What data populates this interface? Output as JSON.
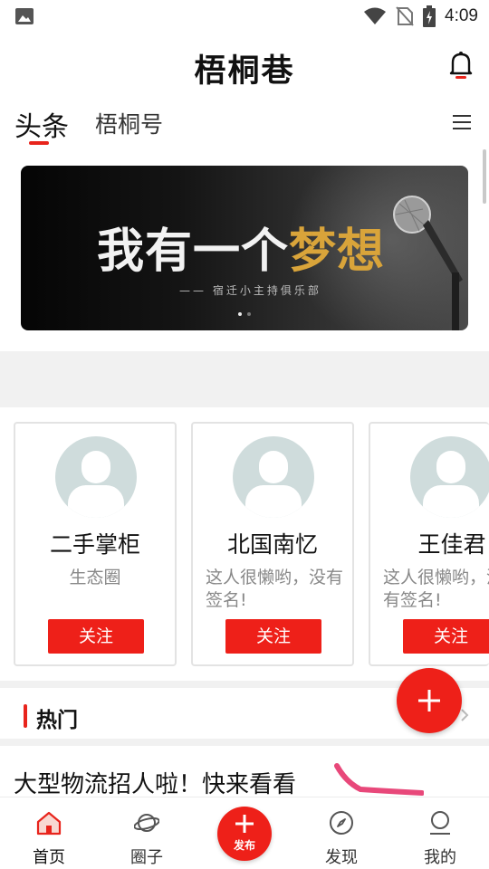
{
  "status_bar": {
    "time": "4:09"
  },
  "header": {
    "title": "梧桐巷"
  },
  "tabs": [
    {
      "label": "头条"
    },
    {
      "label": "梧桐号"
    }
  ],
  "banner": {
    "title_white": "我有一个",
    "title_gold": "梦想",
    "subtitle": "—— 宿迁小主持俱乐部"
  },
  "cards": [
    {
      "name": "二手掌柜",
      "desc": "生态圈",
      "button": "关注"
    },
    {
      "name": "北国南忆",
      "desc": "这人很懒哟，没有签名!",
      "button": "关注"
    },
    {
      "name": "王佳君",
      "desc": "这人很懒哟，没有签名!",
      "button": "关注"
    }
  ],
  "hot_section": {
    "title": "热门"
  },
  "article": {
    "title": "大型物流招人啦！快来看看"
  },
  "bottom_nav": [
    {
      "label": "首页"
    },
    {
      "label": "圈子"
    },
    {
      "label": "发布"
    },
    {
      "label": "发现"
    },
    {
      "label": "我的"
    }
  ],
  "colors": {
    "accent": "#ee2019",
    "gold": "#d9a43a"
  }
}
